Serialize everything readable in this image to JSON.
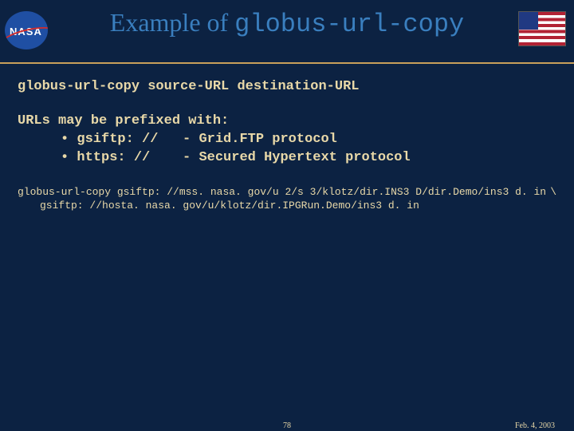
{
  "header": {
    "nasa_text": "NASA",
    "title_prefix": "Example of ",
    "title_mono": "globus-url-copy"
  },
  "usage": "globus-url-copy source-URL destination-URL",
  "prefixes": {
    "head": "URLs may be prefixed with:",
    "items": [
      {
        "proto": "gsiftp: //",
        "desc": "Grid.FTP protocol"
      },
      {
        "proto": "https: //",
        "desc": "Secured Hypertext protocol"
      }
    ]
  },
  "example": {
    "line1_left": "globus-url-copy gsiftp: //mss. nasa. gov/u 2/s 3/klotz/dir.INS3 D/dir.Demo/ins3 d. in",
    "line1_right": "\\",
    "line2": "gsiftp: //hosta. nasa. gov/u/klotz/dir.IPGRun.Demo/ins3 d. in"
  },
  "footer": {
    "page": "78",
    "date": "Feb. 4, 2003"
  }
}
